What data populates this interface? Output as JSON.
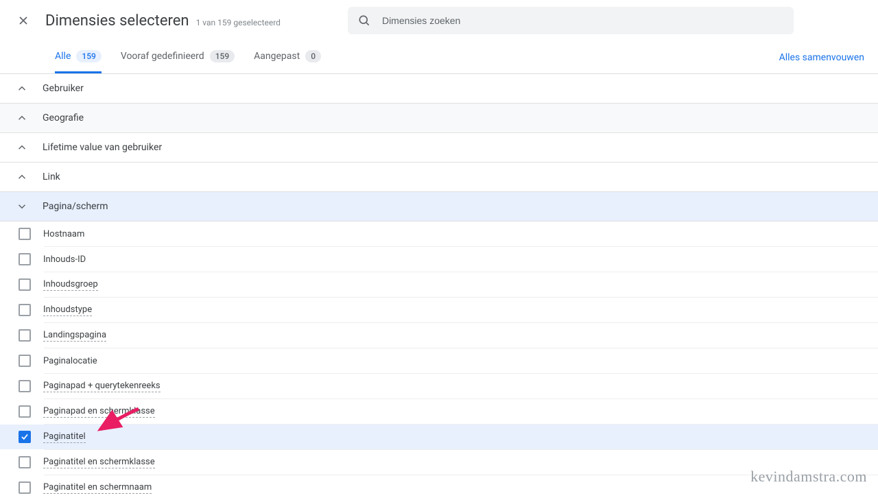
{
  "header": {
    "title": "Dimensies selecteren",
    "subtitle": "1 van 159 geselecteerd"
  },
  "search": {
    "placeholder": "Dimensies zoeken"
  },
  "tabs": {
    "all": {
      "label": "Alle",
      "count": "159"
    },
    "predefined": {
      "label": "Vooraf gedefinieerd",
      "count": "159"
    },
    "custom": {
      "label": "Aangepast",
      "count": "0"
    }
  },
  "collapse_all_label": "Alles samenvouwen",
  "groups": [
    {
      "label": "Gebruiker"
    },
    {
      "label": "Geografie"
    },
    {
      "label": "Lifetime value van gebruiker"
    },
    {
      "label": "Link"
    },
    {
      "label": "Pagina/scherm"
    }
  ],
  "page_items": [
    {
      "label": "Hostnaam",
      "dotted": false,
      "checked": false
    },
    {
      "label": "Inhouds-ID",
      "dotted": false,
      "checked": false
    },
    {
      "label": "Inhoudsgroep",
      "dotted": true,
      "checked": false
    },
    {
      "label": "Inhoudstype",
      "dotted": true,
      "checked": false
    },
    {
      "label": "Landingspagina",
      "dotted": true,
      "checked": false
    },
    {
      "label": "Paginalocatie",
      "dotted": false,
      "checked": false
    },
    {
      "label": "Paginapad + querytekenreeks",
      "dotted": true,
      "checked": false
    },
    {
      "label": "Paginapad en schermklasse",
      "dotted": true,
      "checked": false
    },
    {
      "label": "Paginatitel",
      "dotted": true,
      "checked": true
    },
    {
      "label": "Paginatitel en schermklasse",
      "dotted": true,
      "checked": false
    },
    {
      "label": "Paginatitel en schermnaam",
      "dotted": true,
      "checked": false
    }
  ],
  "watermark": "kevindamstra.com"
}
